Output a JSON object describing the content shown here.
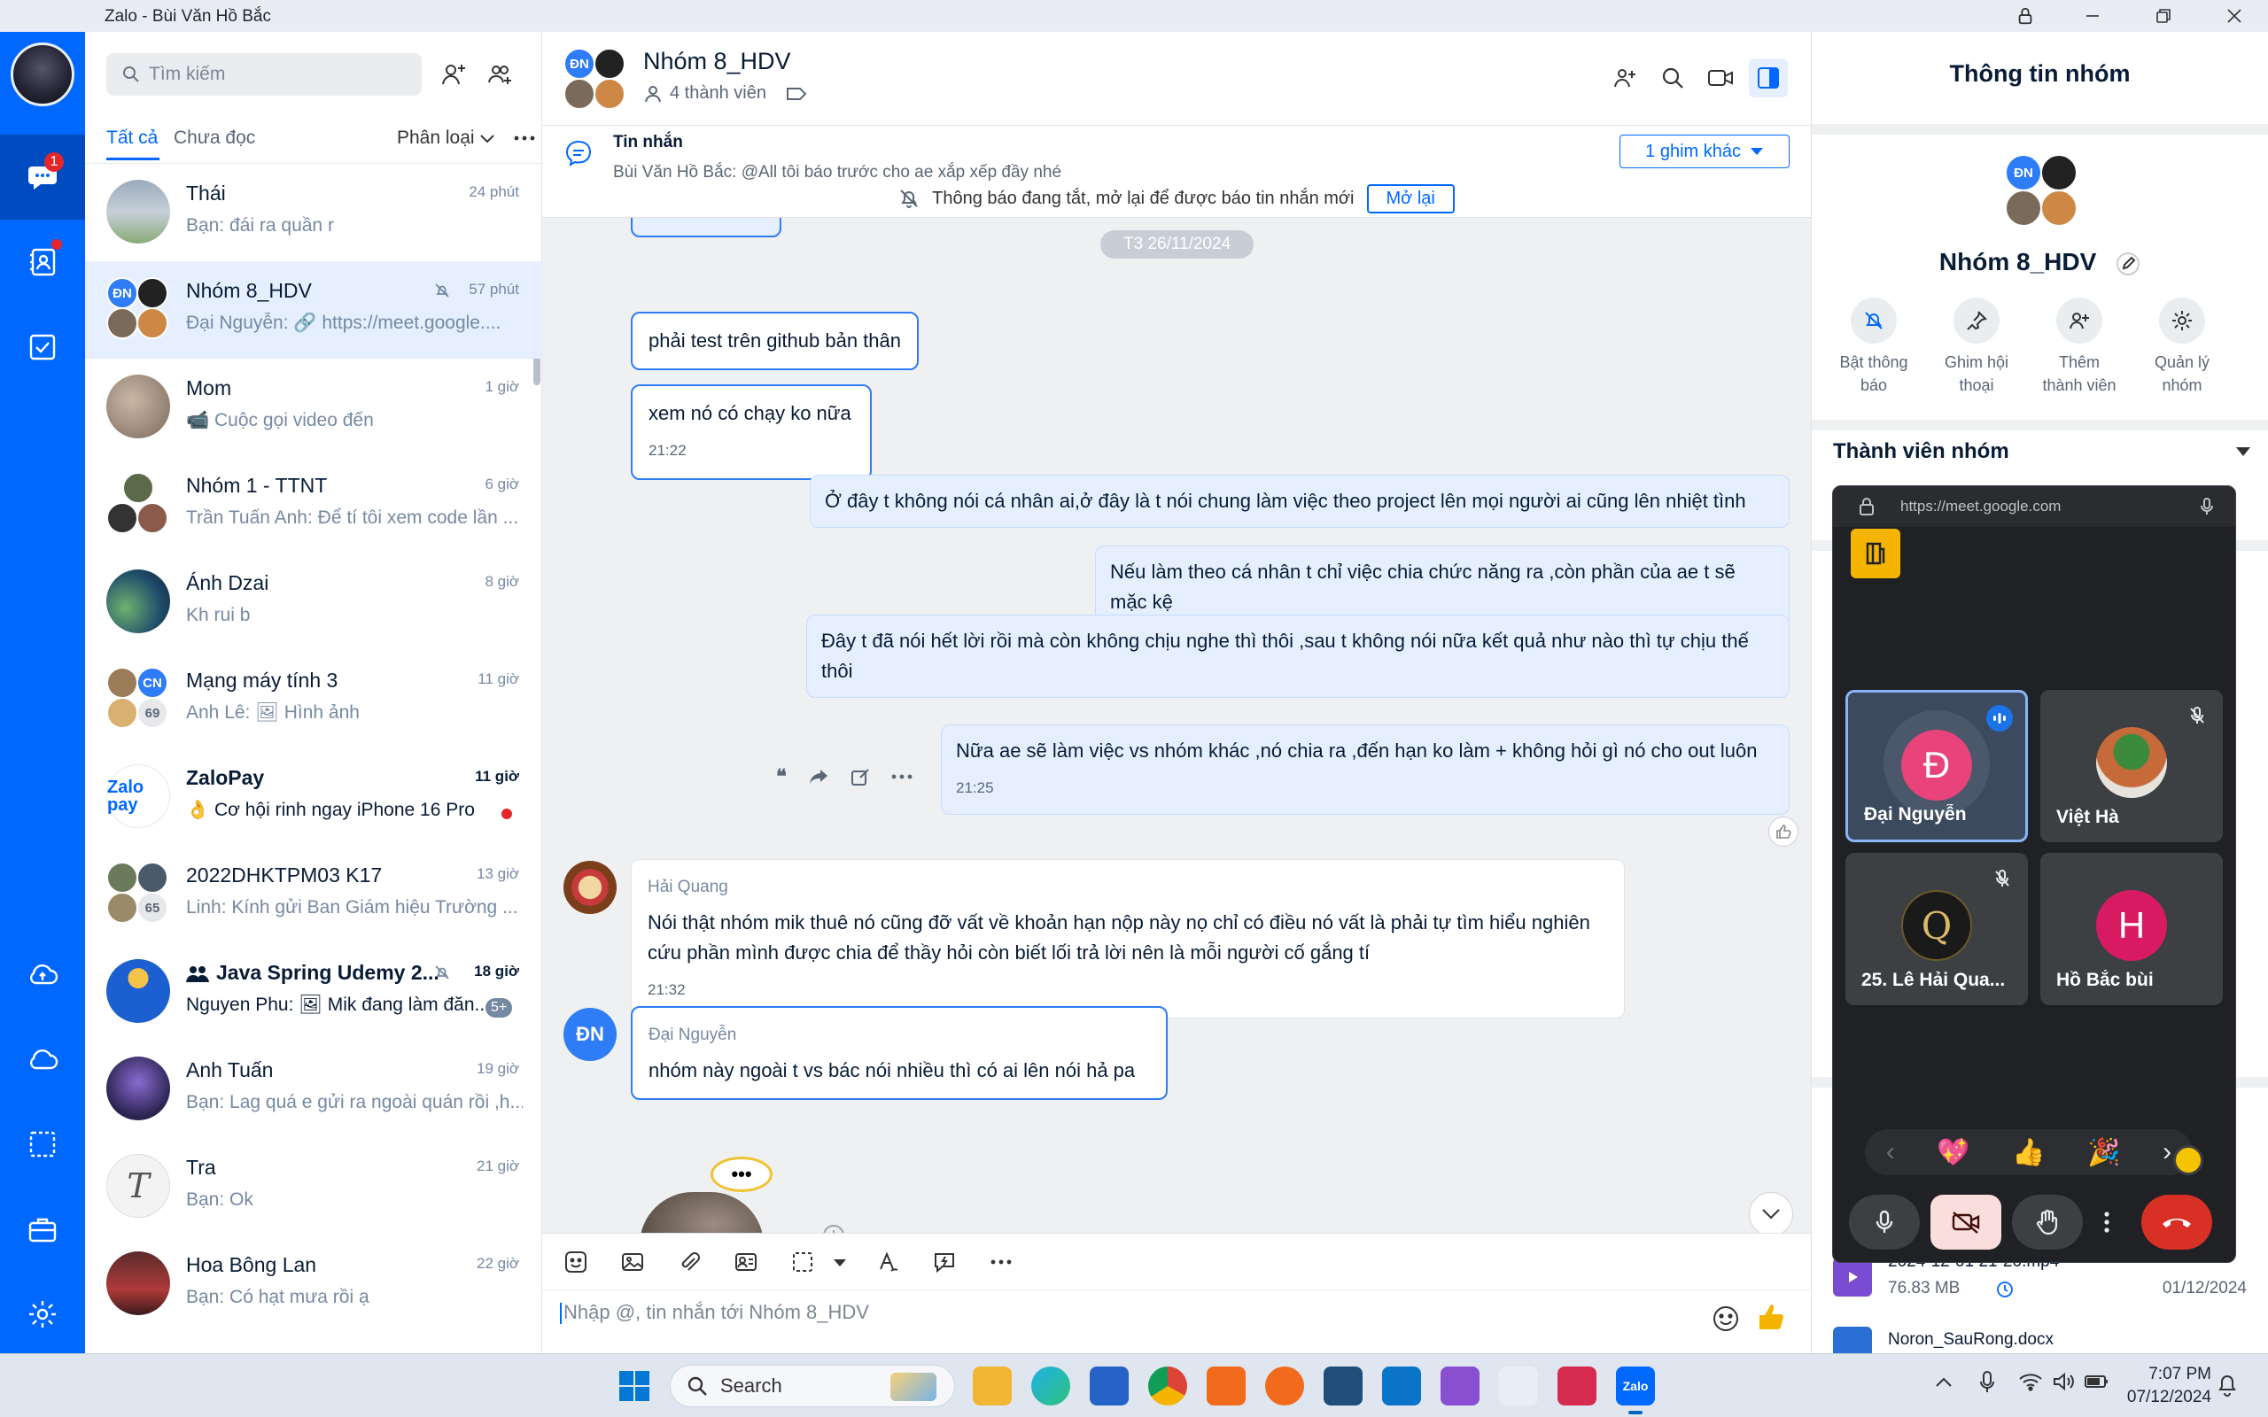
{
  "window": {
    "title": "Zalo - Bùi Văn Hồ Bắc"
  },
  "rail": {
    "messages_badge": "1"
  },
  "list": {
    "search_placeholder": "Tìm kiếm",
    "tab_all": "Tất cả",
    "tab_unread": "Chưa đọc",
    "classify": "Phân loại",
    "items": [
      {
        "name": "Thái",
        "time": "24 phút",
        "preview": "Bạn: đái ra quần r"
      },
      {
        "name": "Nhóm 8_HDV",
        "time": "57 phút",
        "preview": "Đại Nguyễn: 🔗 https://meet.google...."
      },
      {
        "name": "Mom",
        "time": "1 giờ",
        "preview": "📹 Cuộc gọi video đến"
      },
      {
        "name": "Nhóm 1 - TTNT",
        "time": "6 giờ",
        "preview": "Trần Tuấn Anh: Để tí tôi xem code lần ..."
      },
      {
        "name": "Ánh Dzai",
        "time": "8 giờ",
        "preview": "Kh rui b"
      },
      {
        "name": "Mạng máy tính 3",
        "time": "11 giờ",
        "preview": "Anh Lê: 🖼 Hình ảnh"
      },
      {
        "name": "ZaloPay",
        "time": "11 giờ",
        "preview": "👌 Cơ hội rinh ngay iPhone 16 Pro ..."
      },
      {
        "name": "2022DHKTPM03 K17",
        "time": "13 giờ",
        "preview": "Linh: Kính gửi Ban Giám hiệu Trường ..."
      },
      {
        "name": "Java Spring Udemy 2...",
        "time": "18 giờ",
        "preview": "Nguyen Phu: 🖼 Mik đang làm đăn..."
      },
      {
        "name": "Anh Tuấn",
        "time": "19 giờ",
        "preview": "Bạn: Lag quá e gửi ra ngoài quán rồi ,h..."
      },
      {
        "name": "Tra",
        "time": "21 giờ",
        "preview": "Bạn: Ok"
      },
      {
        "name": "Hoa Bông Lan",
        "time": "22 giờ",
        "preview": "Bạn: Có hạt mưa rồi ạ"
      }
    ],
    "mmt_count": "69",
    "k17_count": "65",
    "java_count": "5+"
  },
  "chat": {
    "group_name": "Nhóm 8_HDV",
    "members": "4 thành viên",
    "pin_title": "Tin nhắn",
    "pin_text": "Bùi Văn Hồ Bắc: @All tôi báo trước cho ae xắp xếp đầy nhé",
    "pin_more": "1 ghim khác",
    "notif_text": "Thông báo đang tắt, mở lại để được báo tin nhắn mới",
    "notif_btn": "Mở lại",
    "date_chip": "T3 26/11/2024",
    "messages": [
      {
        "text": "phải test trên github bản thân"
      },
      {
        "text": "xem nó có chạy ko nữa",
        "time": "21:22"
      },
      {
        "text": "Ở đây t không nói cá nhân ai,ở đây là t nói chung làm việc theo project lên mọi người ai cũng lên nhiệt tình"
      },
      {
        "text": "Nếu làm theo cá nhân t chỉ việc chia chức năng ra ,còn phần của ae t sẽ mặc kệ"
      },
      {
        "text": "Đây t đã nói hết lời rồi mà còn không chịu nghe thì thôi ,sau t không nói nữa kết quả như nào thì tự chịu thế thôi"
      },
      {
        "text": "Nữa ae sẽ làm việc vs nhóm khác ,nó chia ra ,đến hạn ko làm + không hỏi gì nó cho out luôn",
        "time": "21:25"
      },
      {
        "sender": "Hải Quang",
        "text": "Nói thật nhóm mik thuê nó cũng đỡ vất về khoản hạn nộp này nọ chỉ có điều nó vất là phải tự tìm hiểu nghiên cứu phần mình được chia để thầy hỏi còn biết lối trả lời nên là mỗi người cố gắng tí",
        "time": "21:32"
      },
      {
        "sender": "Đại Nguyễn",
        "text": "nhóm này ngoài t vs bác nói nhiều thì có ai lên nói hả pa"
      }
    ],
    "input_placeholder": "Nhập @, tin nhắn tới Nhóm 8_HDV"
  },
  "info": {
    "title": "Thông tin nhóm",
    "group_name": "Nhóm 8_HDV",
    "actions": [
      {
        "l1": "Bật thông",
        "l2": "báo"
      },
      {
        "l1": "Ghim hội",
        "l2": "thoại"
      },
      {
        "l1": "Thêm",
        "l2": "thành viên"
      },
      {
        "l1": "Quản lý",
        "l2": "nhóm"
      }
    ],
    "members_header": "Thành viên nhóm",
    "file1_name": "2024-12-01 21-20.mp4",
    "file1_size": "76.83 MB",
    "file1_date": "01/12/2024",
    "file2_name": "Noron_SauRong.docx"
  },
  "meet": {
    "url": "https://meet.google.com",
    "participants": [
      {
        "name": "Đại Nguyễn",
        "initial": "Đ",
        "color": "#e8437a"
      },
      {
        "name": "Việt Hà",
        "initial": "",
        "color": "#8a6a4a"
      },
      {
        "name": "25. Lê Hải Qua...",
        "initial": "Q",
        "color": "#1a1a1a"
      },
      {
        "name": "Hồ Bắc bùi",
        "initial": "H",
        "color": "#d81b60"
      }
    ],
    "reactions": [
      "💖",
      "👍",
      "🎉"
    ]
  },
  "taskbar": {
    "search": "Search",
    "time": "7:07 PM",
    "date": "07/12/2024",
    "zalo_label": "Zalo"
  },
  "avatars": {
    "dn": "ĐN",
    "cn": "CN",
    "zalopay": "Zalo pay"
  }
}
